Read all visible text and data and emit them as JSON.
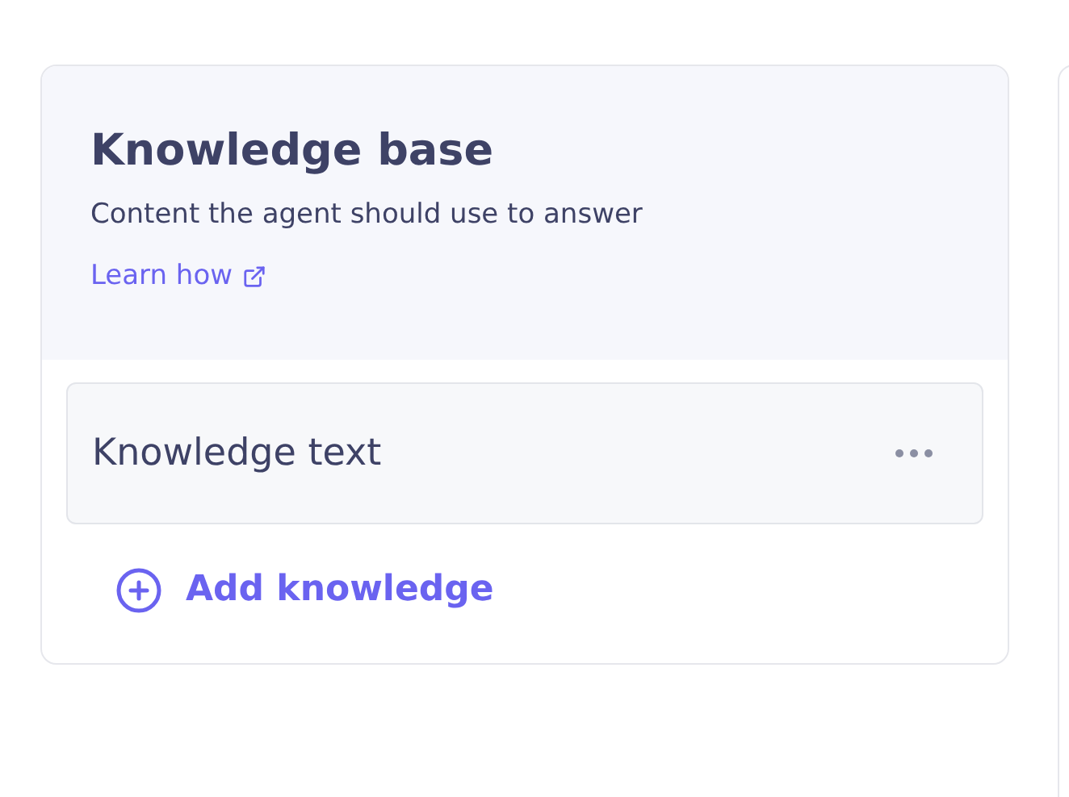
{
  "panel": {
    "title": "Knowledge base",
    "subtitle": "Content the agent should use to answer",
    "link": "Learn how"
  },
  "items": [
    {
      "label": "Knowledge text"
    }
  ],
  "add_button": {
    "label": "Add knowledge"
  }
}
